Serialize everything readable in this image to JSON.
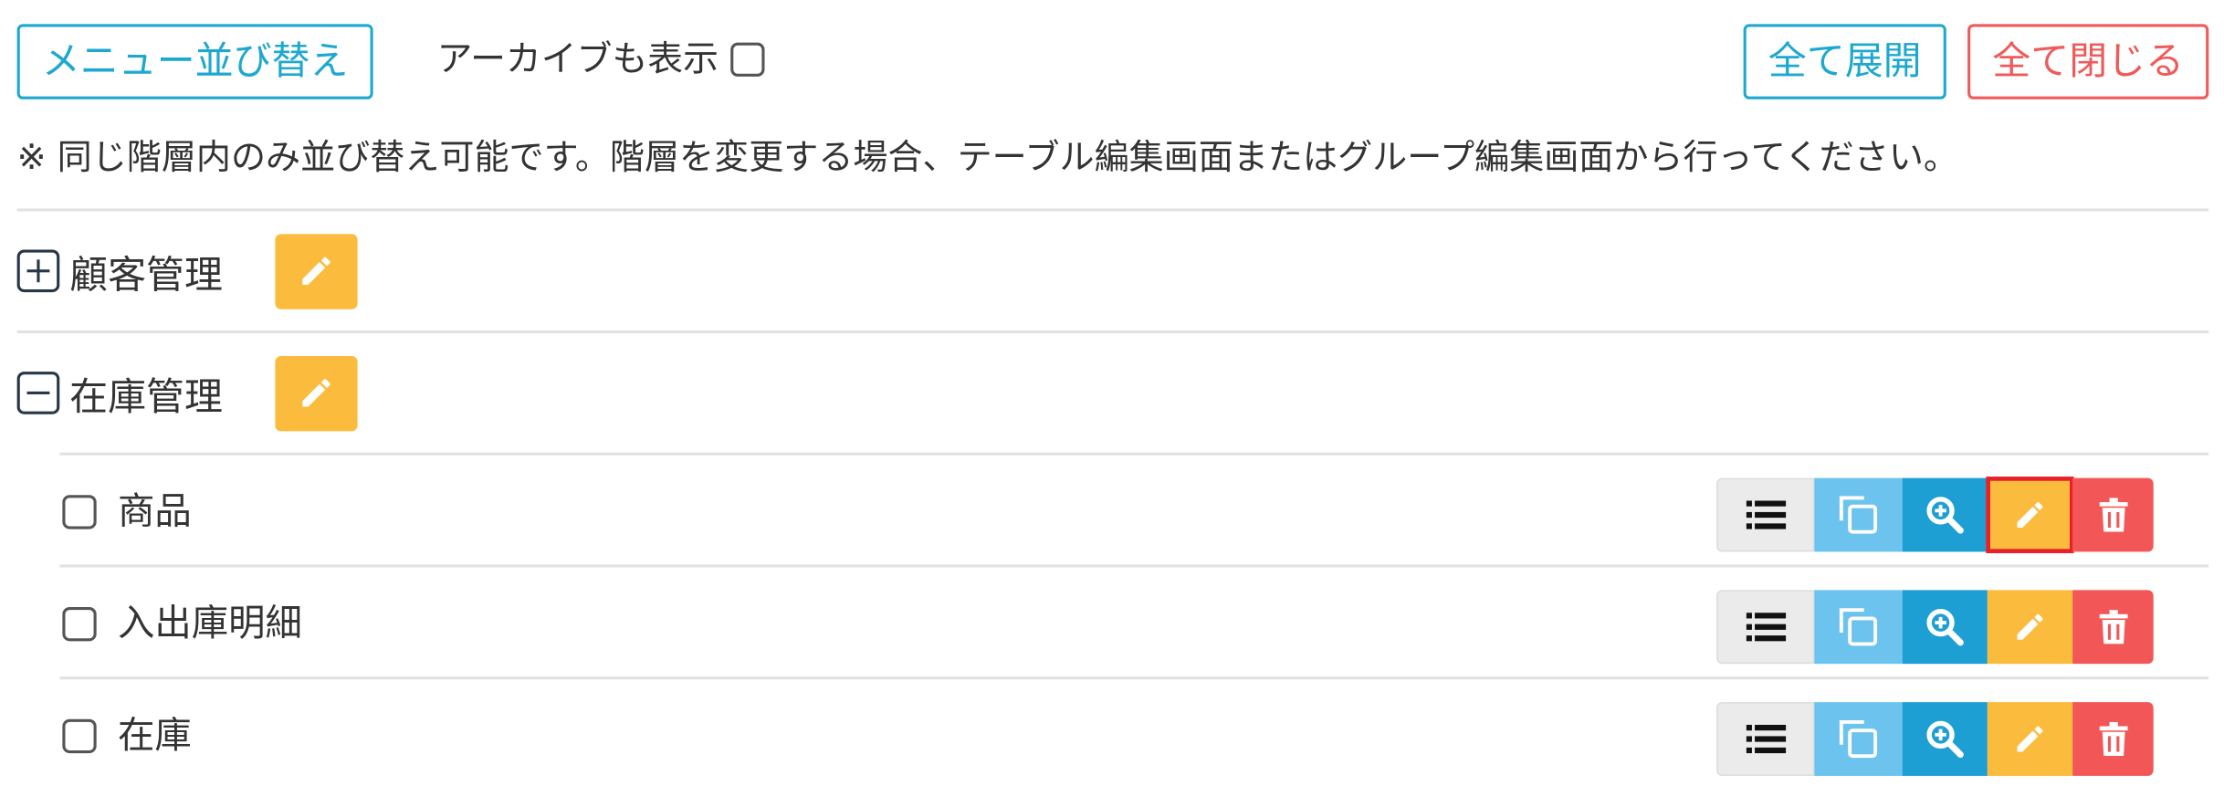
{
  "toolbar": {
    "sort_button": "メニュー並び替え",
    "archive_label": "アーカイブも表示",
    "expand_all_button": "全て展開",
    "collapse_all_button": "全て閉じる"
  },
  "note": "※ 同じ階層内のみ並び替え可能です。階層を変更する場合、テーブル編集画面またはグループ編集画面から行ってください。",
  "groups": [
    {
      "label": "顧客管理",
      "state": "collapsed"
    },
    {
      "label": "在庫管理",
      "state": "expanded"
    }
  ],
  "tables": [
    {
      "label": "商品",
      "edit_highlighted": true
    },
    {
      "label": "入出庫明細",
      "edit_highlighted": false
    },
    {
      "label": "在庫",
      "edit_highlighted": false
    }
  ],
  "colors": {
    "accent_blue": "#1ea8d0",
    "danger_red": "#ef5a5a",
    "edit_yellow": "#fbbb3c",
    "highlight_red": "#e8202a"
  },
  "icons": {
    "list": "list-icon",
    "copy": "copy-icon",
    "zoom": "zoom-in-icon",
    "edit": "pencil-icon",
    "delete": "trash-icon"
  }
}
